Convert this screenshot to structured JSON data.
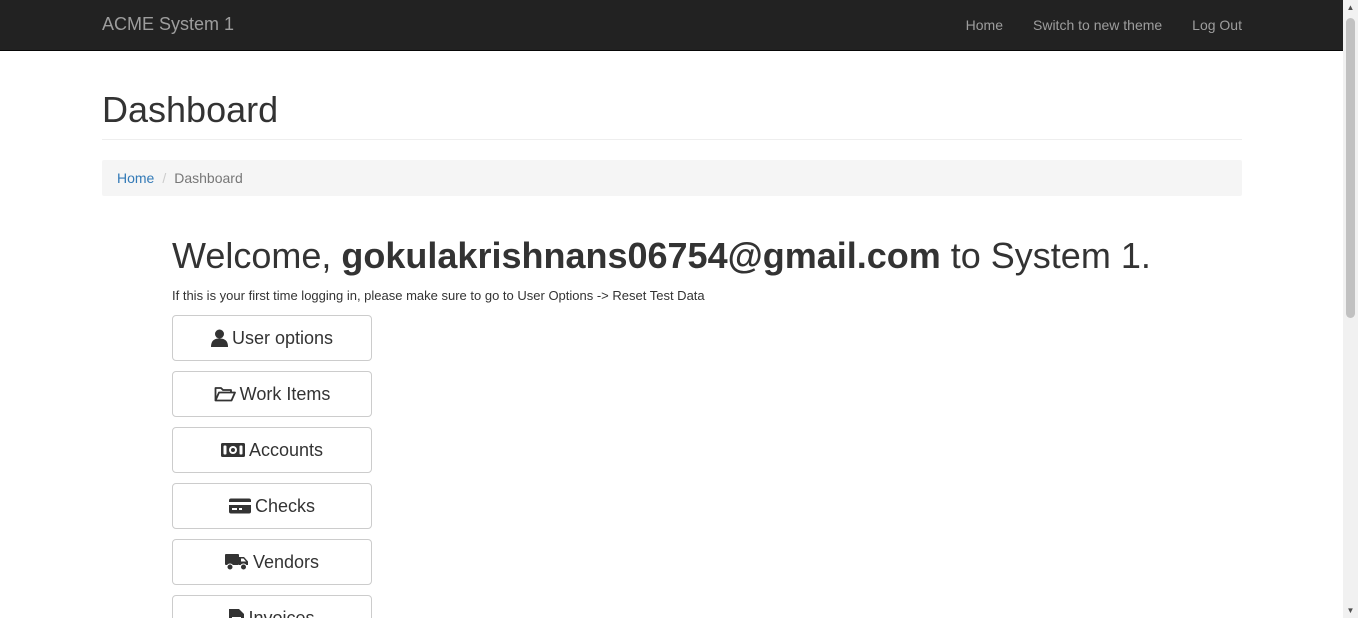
{
  "navbar": {
    "brand": "ACME System 1",
    "links": [
      "Home",
      "Switch to new theme",
      "Log Out"
    ]
  },
  "page": {
    "title": "Dashboard"
  },
  "breadcrumb": {
    "home": "Home",
    "current": "Dashboard"
  },
  "welcome": {
    "prefix": "Welcome,",
    "user": "gokulakrishnans06754@gmail.com",
    "suffix": "to System 1.",
    "hint": "If this is your first time logging in, please make sure to go to User Options -> Reset Test Data"
  },
  "buttons": [
    {
      "label": "User options",
      "icon": "user-icon"
    },
    {
      "label": "Work Items",
      "icon": "folder-open-icon"
    },
    {
      "label": "Accounts",
      "icon": "money-icon"
    },
    {
      "label": "Checks",
      "icon": "credit-card-icon"
    },
    {
      "label": "Vendors",
      "icon": "truck-icon"
    },
    {
      "label": "Invoices",
      "icon": "file-icon"
    }
  ],
  "colors": {
    "navbar_bg": "#222222",
    "navbar_text": "#9d9d9d",
    "link": "#337ab7",
    "breadcrumb_bg": "#f5f5f5"
  }
}
